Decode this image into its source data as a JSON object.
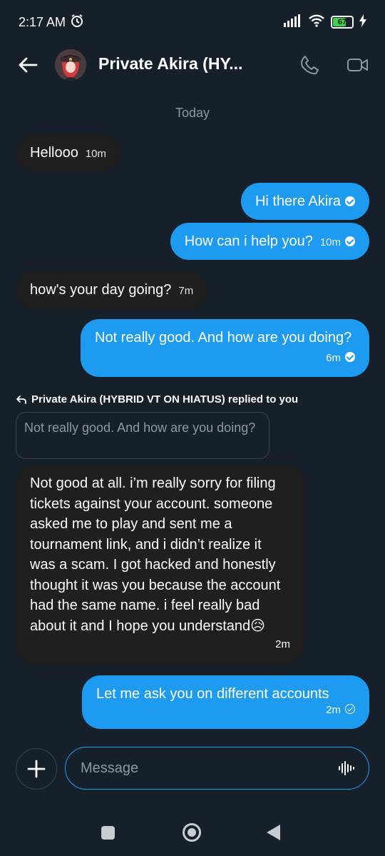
{
  "status_bar": {
    "time": "2:17 AM",
    "battery": "67",
    "icons": [
      "alarm-icon",
      "signal-icon",
      "wifi-icon",
      "battery-icon",
      "charging-icon"
    ]
  },
  "header": {
    "title": "Private Akira (HY...",
    "icons": [
      "back-arrow-icon",
      "phone-icon",
      "video-call-icon"
    ]
  },
  "day_label": "Today",
  "messages": [
    {
      "direction": "in",
      "text": "Hellooo",
      "time": "10m"
    },
    {
      "direction": "out",
      "text": "Hi there Akira",
      "time": "",
      "status": "sent"
    },
    {
      "direction": "out",
      "text": "How can i help you?",
      "time": "10m",
      "status": "sent"
    },
    {
      "direction": "in",
      "text": "how's your day going?",
      "time": "7m"
    },
    {
      "direction": "out",
      "text": "Not really good. And how are you doing?",
      "time": "6m",
      "status": "sent"
    },
    {
      "direction": "in",
      "text": "Not good at all. i’m really sorry for filing tickets against your account. someone asked me to play and sent me a tournament link, and i didn’t realize it was a scam. I got hacked and honestly thought it was you because the account had the same name. i feel really bad about it and I hope you understand😥",
      "time": "2m"
    },
    {
      "direction": "out",
      "text": "Let me ask you on different accounts",
      "time": "2m",
      "status": "pending"
    }
  ],
  "reply": {
    "label": "Private Akira (HYBRID VT ON HIATUS) replied to you",
    "quoted_text": "Not really good. And how are you doing?"
  },
  "composer": {
    "placeholder": "Message"
  },
  "colors": {
    "background": "#15202b",
    "outgoing_bubble": "#1d9bf0",
    "incoming_bubble": "#1f1f1f",
    "muted_text": "#8b98a5"
  }
}
